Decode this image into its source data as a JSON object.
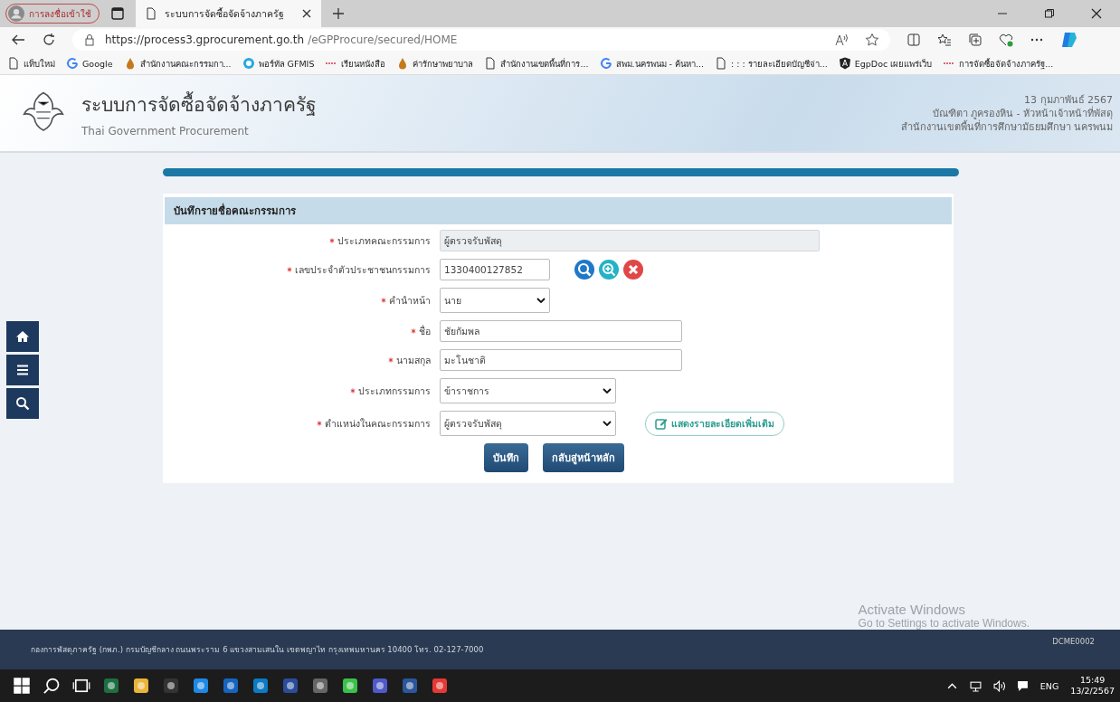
{
  "browser": {
    "profile_label": "การลงชื่อเข้าใช้",
    "tabs": [
      {
        "title": "ระบบการจัดซื้อจัดจ้างภาครัฐ",
        "selected": true
      }
    ],
    "url_host": "https://process3.gprocurement.go.th",
    "url_path": "/eGPProcure/secured/HOME",
    "bookmarks": [
      {
        "kind": "page",
        "label": "แท็บใหม่"
      },
      {
        "kind": "google",
        "label": "Google"
      },
      {
        "kind": "drop",
        "label": "สำนักงานคณะกรรมกา..."
      },
      {
        "kind": "globe",
        "label": "พอร์ทัล GFMIS"
      },
      {
        "kind": "dash",
        "label": "เรียนหนังสือ"
      },
      {
        "kind": "drop",
        "label": "ค่ารักษาพยาบาล"
      },
      {
        "kind": "page",
        "label": "สำนักงานเขตพื้นที่การ..."
      },
      {
        "kind": "google",
        "label": "สพม.นครพนม - ค้นหา..."
      },
      {
        "kind": "page",
        "label": ": : : รายละเอียดบัญชีจ่า..."
      },
      {
        "kind": "angular",
        "label": "EgpDoc เผยแพร่เว็บ"
      },
      {
        "kind": "dash",
        "label": "การจัดซื้อจัดจ้างภาครัฐ..."
      }
    ]
  },
  "header": {
    "title": "ระบบการจัดซื้อจัดจ้างภาครัฐ",
    "subtitle": "Thai Government Procurement",
    "date": "13 กุมภาพันธ์ 2567",
    "user": "บัณฑิตา ภูครองหิน - หัวหน้าเจ้าหน้าที่พัสดุ",
    "office": "สำนักงานเขตพื้นที่การศึกษามัธยมศึกษา นครพนม"
  },
  "form": {
    "title": "บันทึกรายชื่อคณะกรรมการ",
    "fields": [
      {
        "kind": "readonly",
        "label": "ประเภทคณะกรรมการ",
        "required": true,
        "value": "ผู้ตรวจรับพัสดุ"
      },
      {
        "kind": "lookup",
        "label": "เลขประจำตัวประชาชนกรรมการ",
        "required": true,
        "value": "1330400127852"
      },
      {
        "kind": "short_select",
        "label": "คำนำหน้า",
        "required": true,
        "value": "นาย"
      },
      {
        "kind": "text",
        "label": "ชื่อ",
        "required": true,
        "value": "ชัยกัมพล"
      },
      {
        "kind": "text",
        "label": "นามสกุล",
        "required": true,
        "value": "มะโนชาติ"
      },
      {
        "kind": "select",
        "label": "ประเภทกรรมการ",
        "required": true,
        "value": "ข้าราชการ"
      },
      {
        "kind": "select",
        "label": "ตำแหน่งในคณะกรรมการ",
        "required": true,
        "value": "ผู้ตรวจรับพัสดุ",
        "link": "แสดงรายละเอียดเพิ่มเติม"
      }
    ],
    "buttons": [
      "บันทึก",
      "กลับสู่หน้าหลัก"
    ]
  },
  "footer": {
    "address": "กองการพัสดุภาครัฐ (กพภ.) กรมบัญชีกลาง ถนนพระราม 6 แขวงสามเสนใน เขตพญาไท กรุงเทพมหานคร 10400 โทร. 02-127-7000",
    "code": "DCME0002"
  },
  "activation": {
    "title": "Activate Windows",
    "hint": "Go to Settings to activate Windows."
  },
  "taskbar": {
    "language": "ENG",
    "time": "15:49",
    "date": "13/2/2567"
  }
}
